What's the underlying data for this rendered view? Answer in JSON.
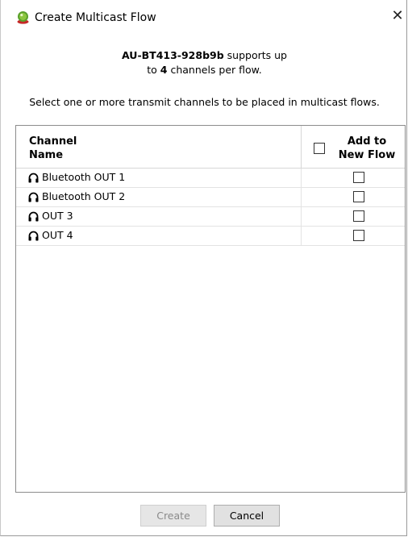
{
  "window": {
    "title": "Create Multicast Flow",
    "close_glyph": "✕"
  },
  "info": {
    "device_name": "AU-BT413-928b9b",
    "supports_text": " supports up",
    "line2_prefix": "to ",
    "channel_count": "4",
    "line2_suffix": " channels per flow."
  },
  "instruction": "Select one or more transmit channels to be placed in multicast flows.",
  "grid": {
    "header_channel_line1": "Channel",
    "header_channel_line2": "Name",
    "header_add_line1": "Add to",
    "header_add_line2": "New Flow",
    "rows": [
      {
        "label": "Bluetooth OUT 1",
        "icon": "headphones-icon",
        "checked": false
      },
      {
        "label": "Bluetooth OUT 2",
        "icon": "headphones-icon",
        "checked": false
      },
      {
        "label": "OUT 3",
        "icon": "headphones-icon",
        "checked": false
      },
      {
        "label": "OUT 4",
        "icon": "headphones-icon",
        "checked": false
      }
    ]
  },
  "buttons": {
    "create_label": "Create",
    "cancel_label": "Cancel"
  }
}
